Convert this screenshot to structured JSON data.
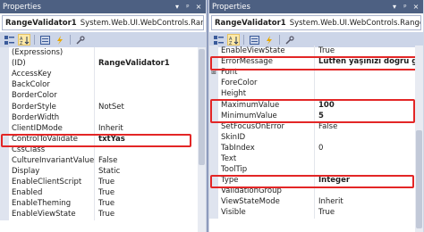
{
  "left_panel": {
    "title": "Properties",
    "title_buttons": [
      "▾",
      "ᵖ",
      "×"
    ],
    "object_name": "RangeValidator1",
    "object_type": "System.Web.UI.WebControls.RangeValidato",
    "properties": [
      {
        "name": "(Expressions)",
        "value": ""
      },
      {
        "name": "(ID)",
        "value": "RangeValidator1",
        "bold": true
      },
      {
        "name": "AccessKey",
        "value": ""
      },
      {
        "name": "BackColor",
        "value": ""
      },
      {
        "name": "BorderColor",
        "value": ""
      },
      {
        "name": "BorderStyle",
        "value": "NotSet"
      },
      {
        "name": "BorderWidth",
        "value": ""
      },
      {
        "name": "ClientIDMode",
        "value": "Inherit"
      },
      {
        "name": "ControlToValidate",
        "value": "txtYas",
        "bold": true
      },
      {
        "name": "CssClass",
        "value": ""
      },
      {
        "name": "CultureInvariantValues",
        "value": "False"
      },
      {
        "name": "Display",
        "value": "Static"
      },
      {
        "name": "EnableClientScript",
        "value": "True"
      },
      {
        "name": "Enabled",
        "value": "True"
      },
      {
        "name": "EnableTheming",
        "value": "True"
      },
      {
        "name": "EnableViewState",
        "value": "True"
      }
    ]
  },
  "right_panel": {
    "title": "Properties",
    "title_buttons": [
      "▾",
      "ᵖ",
      "×"
    ],
    "object_name": "RangeValidator1",
    "object_type": "System.Web.UI.WebControls.RangeValidator",
    "properties": [
      {
        "name": "EnableViewState",
        "value": "True"
      },
      {
        "name": "ErrorMessage",
        "value": "Lütfen yaşınızı doğru giriniz!",
        "bold": true
      },
      {
        "name": "Font",
        "value": "",
        "expander": "⊞"
      },
      {
        "name": "ForeColor",
        "value": ""
      },
      {
        "name": "Height",
        "value": ""
      },
      {
        "name": "MaximumValue",
        "value": "100",
        "bold": true
      },
      {
        "name": "MinimumValue",
        "value": "5",
        "bold": true
      },
      {
        "name": "SetFocusOnError",
        "value": "False"
      },
      {
        "name": "SkinID",
        "value": ""
      },
      {
        "name": "TabIndex",
        "value": "0"
      },
      {
        "name": "Text",
        "value": ""
      },
      {
        "name": "ToolTip",
        "value": ""
      },
      {
        "name": "Type",
        "value": "Integer",
        "bold": true
      },
      {
        "name": "ValidationGroup",
        "value": ""
      },
      {
        "name": "ViewStateMode",
        "value": "Inherit"
      },
      {
        "name": "Visible",
        "value": "True"
      }
    ]
  },
  "toolbar_icons": [
    "categorized-icon",
    "alphabetical-icon",
    "properties-icon",
    "events-icon",
    "property-pages-icon"
  ],
  "colors": {
    "titlebar": "#4d6082",
    "toolbar": "#ccd5e8",
    "highlight": "#e32626",
    "gutter": "#dfe4ef"
  }
}
